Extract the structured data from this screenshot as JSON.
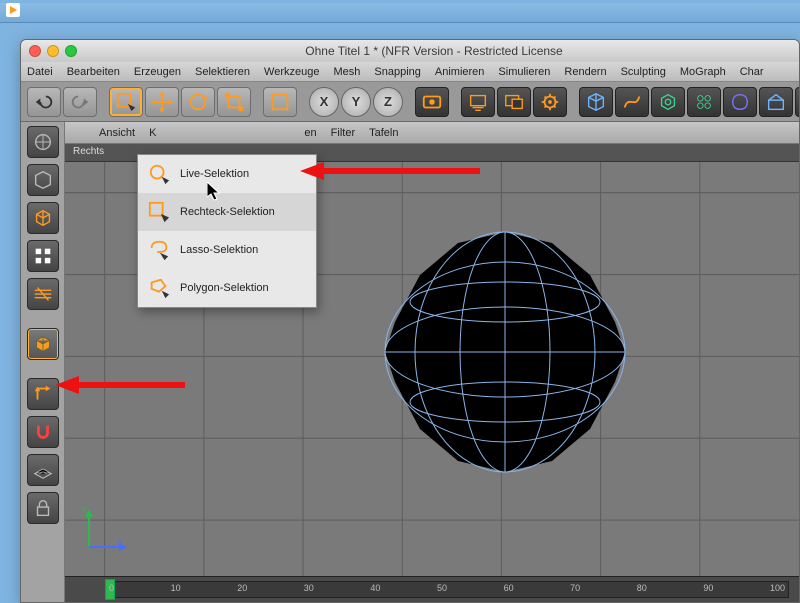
{
  "window": {
    "title": "Ohne Titel 1 * (NFR Version - Restricted License"
  },
  "menubar": [
    "Datei",
    "Bearbeiten",
    "Erzeugen",
    "Selektieren",
    "Werkzeuge",
    "Mesh",
    "Snapping",
    "Animieren",
    "Simulieren",
    "Rendern",
    "Sculpting",
    "MoGraph",
    "Char"
  ],
  "axes": [
    "X",
    "Y",
    "Z"
  ],
  "viewport_tabs": [
    "Ansicht",
    "K",
    "en",
    "Filter",
    "Tafeln"
  ],
  "viewport_label": "Rechts",
  "popup": {
    "items": [
      {
        "icon": "live-select-icon",
        "label": "Live-Selektion"
      },
      {
        "icon": "rect-select-icon",
        "label": "Rechteck-Selektion"
      },
      {
        "icon": "lasso-select-icon",
        "label": "Lasso-Selektion"
      },
      {
        "icon": "poly-select-icon",
        "label": "Polygon-Selektion"
      }
    ]
  },
  "timeline": {
    "start": 0,
    "end": 100,
    "ticks": [
      "0",
      "10",
      "20",
      "30",
      "40",
      "50",
      "60",
      "70",
      "80",
      "90",
      "100"
    ]
  },
  "gizmo": {
    "y": "Y",
    "z": "Z"
  },
  "colors": {
    "accent": "#ff9a1f",
    "wire": "#8ab4e8",
    "arrow": "#e11"
  }
}
